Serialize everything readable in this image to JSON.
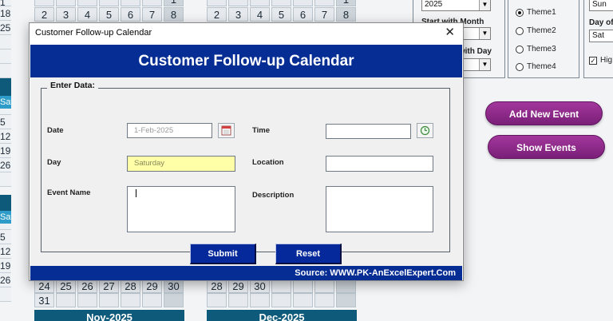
{
  "background_calendar": {
    "left_partial": {
      "top_dates": [
        "1",
        "18",
        "25"
      ],
      "block1_header": "Sat",
      "block1_dates": [
        "5",
        "12",
        "19",
        "26"
      ],
      "block2_header": "Sat",
      "block2_dates": [
        "5",
        "12",
        "19",
        "26"
      ]
    },
    "cal_a": {
      "row1": [
        "",
        "",
        "",
        "",
        "",
        "",
        "1"
      ],
      "row2": [
        "2",
        "3",
        "4",
        "5",
        "6",
        "7",
        "8"
      ],
      "row_bottom1": [
        "24",
        "25",
        "26",
        "27",
        "28",
        "29",
        "30"
      ],
      "row_bottom2": [
        "31",
        "",
        "",
        "",
        "",
        "",
        ""
      ],
      "next_month": "Nov-2025"
    },
    "cal_b": {
      "row1": [
        "",
        "",
        "",
        "",
        "",
        "",
        "1"
      ],
      "row2": [
        "2",
        "3",
        "4",
        "5",
        "6",
        "7",
        "8"
      ],
      "row_bottom1": [
        "28",
        "29",
        "30",
        "",
        "",
        "",
        ""
      ],
      "row_bottom2": [
        "",
        "",
        "",
        "",
        "",
        "",
        ""
      ],
      "next_month": "Dec-2025"
    }
  },
  "settings_panel": {
    "year_value": "2025",
    "start_month_label": "Start with Month",
    "start_day_label": "Start with Day",
    "themes": [
      {
        "label": "Theme1",
        "checked": true
      },
      {
        "label": "Theme2",
        "checked": false
      },
      {
        "label": "Theme3",
        "checked": false
      },
      {
        "label": "Theme4",
        "checked": false
      }
    ],
    "week_start_value": "Sun",
    "day_of_week_label": "Day of W",
    "day_of_week_value": "Sat",
    "highlight_label": "Hig",
    "highlight_checked": true
  },
  "actions": {
    "add_event": "Add New Event",
    "show_events": "Show Events"
  },
  "dialog": {
    "window_title": "Customer Follow-up Calendar",
    "close_glyph": "✕",
    "header": "Customer Follow-up Calendar",
    "group_label": "Enter Data:",
    "date_label": "Date",
    "date_value": "1-Feb-2025",
    "time_label": "Time",
    "time_value": "",
    "day_label": "Day",
    "day_value": "Saturday",
    "location_label": "Location",
    "location_value": "",
    "event_name_label": "Event Name",
    "event_name_value": "",
    "description_label": "Description",
    "description_value": "",
    "submit_label": "Submit",
    "reset_label": "Reset",
    "footer": "Source: WWW.PK-AnExcelExpert.Com",
    "icons": {
      "date_picker": "calendar-icon",
      "time_picker": "clock-icon"
    },
    "colors": {
      "header_bg": "#052d94",
      "day_field_bg": "#ffffa8",
      "button_bg": "#05299a"
    }
  }
}
